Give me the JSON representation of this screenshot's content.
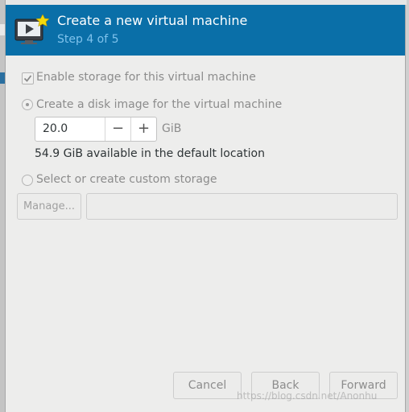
{
  "header": {
    "title": "Create a new virtual machine",
    "step": "Step 4 of 5",
    "icon": "virtual-machine-icon"
  },
  "storage": {
    "enable_label": "Enable storage for this virtual machine",
    "enable_checked": true,
    "create_disk_label": "Create a disk image for the virtual machine",
    "create_disk_selected": true,
    "size_value": "20.0",
    "decrement_symbol": "−",
    "increment_symbol": "+",
    "unit": "GiB",
    "available_text": "54.9 GiB available in the default location",
    "custom_label": "Select or create custom storage",
    "custom_selected": false,
    "manage_label": "Manage...",
    "custom_path_value": ""
  },
  "footer": {
    "cancel_label": "Cancel",
    "back_label": "Back",
    "forward_label": "Forward"
  },
  "watermark": "https://blog.csdn.net/Anonhu",
  "colors": {
    "header_bg": "#0a6fa8",
    "header_subtitle": "#7ec2ec",
    "dialog_bg": "#ededec"
  }
}
